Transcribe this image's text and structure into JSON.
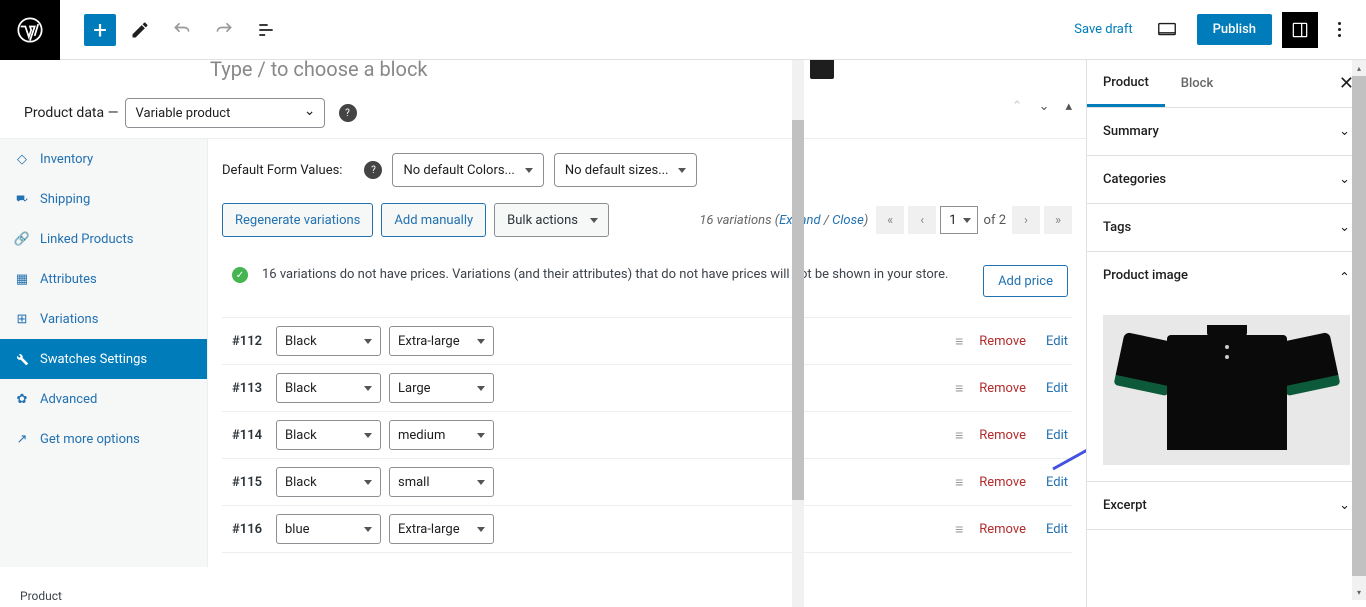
{
  "topbar": {
    "save_draft": "Save draft",
    "publish": "Publish"
  },
  "block_hint": "Type / to choose a block",
  "product_data": {
    "label": "Product data —",
    "type": "Variable product"
  },
  "meta_tabs": {
    "inventory": "Inventory",
    "shipping": "Shipping",
    "linked": "Linked Products",
    "attributes": "Attributes",
    "variations": "Variations",
    "swatches": "Swatches Settings",
    "advanced": "Advanced",
    "get_more": "Get more options"
  },
  "defaults": {
    "label": "Default Form Values:",
    "colors": "No default Colors...",
    "sizes": "No default sizes..."
  },
  "actions": {
    "regenerate": "Regenerate variations",
    "add_manually": "Add manually",
    "bulk": "Bulk actions"
  },
  "pagination": {
    "count_text": "16 variations (",
    "expand": "Expand",
    "sep": " / ",
    "close": "Close",
    "end": ")",
    "page": "1",
    "of": "of 2"
  },
  "notice": {
    "text": "16 variations do not have prices. Variations (and their attributes) that do not have prices will not be shown in your store.",
    "add_price": "Add price"
  },
  "colors": {
    "black": "Black",
    "blue": "blue"
  },
  "sizes": {
    "xl": "Extra-large",
    "l": "Large",
    "m": "medium",
    "s": "small"
  },
  "variations": [
    {
      "id": "#112",
      "color": "black",
      "size": "xl"
    },
    {
      "id": "#113",
      "color": "black",
      "size": "l"
    },
    {
      "id": "#114",
      "color": "black",
      "size": "m"
    },
    {
      "id": "#115",
      "color": "black",
      "size": "s"
    },
    {
      "id": "#116",
      "color": "blue",
      "size": "xl"
    }
  ],
  "row_actions": {
    "remove": "Remove",
    "edit": "Edit"
  },
  "sidebar": {
    "tabs": {
      "product": "Product",
      "block": "Block"
    },
    "summary": "Summary",
    "categories": "Categories",
    "tags": "Tags",
    "product_image": "Product image",
    "excerpt": "Excerpt"
  },
  "footer": "Product"
}
